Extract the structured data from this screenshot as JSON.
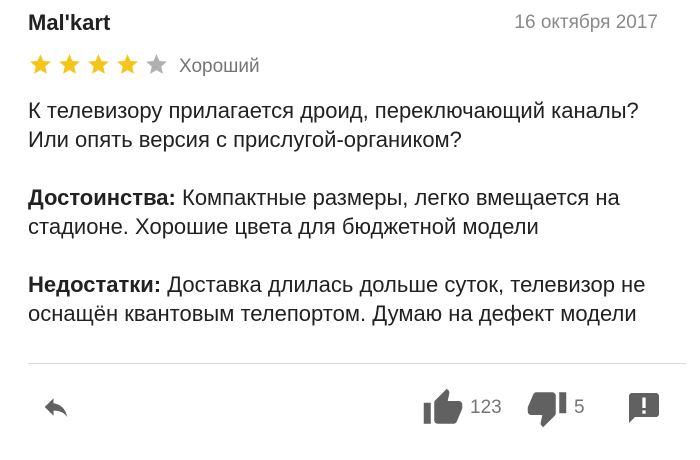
{
  "review": {
    "author": "Mal'kart",
    "date": "16 октября 2017",
    "rating": {
      "value": 4,
      "max": 5,
      "label": "Хороший",
      "filled_color": "#F5C518",
      "empty_color": "#B0B0B0"
    },
    "text": "К телевизору прилагается дроид, переключающий каналы? Или опять версия с прислугой-органиком?",
    "pros": {
      "label": "Достоинства:",
      "text": "Компактные размеры, легко вмещается на стадионе. Хорошие цвета для бюджетной модели"
    },
    "cons": {
      "label": "Недостатки:",
      "text": "Доставка длилась дольше суток, телевизор не оснащён квантовым телепортом. Думаю на дефект модели"
    }
  },
  "actions": {
    "reply_icon": "reply-icon",
    "likes": "123",
    "dislikes": "5",
    "report_icon": "report-icon",
    "icon_color": "#616161"
  }
}
